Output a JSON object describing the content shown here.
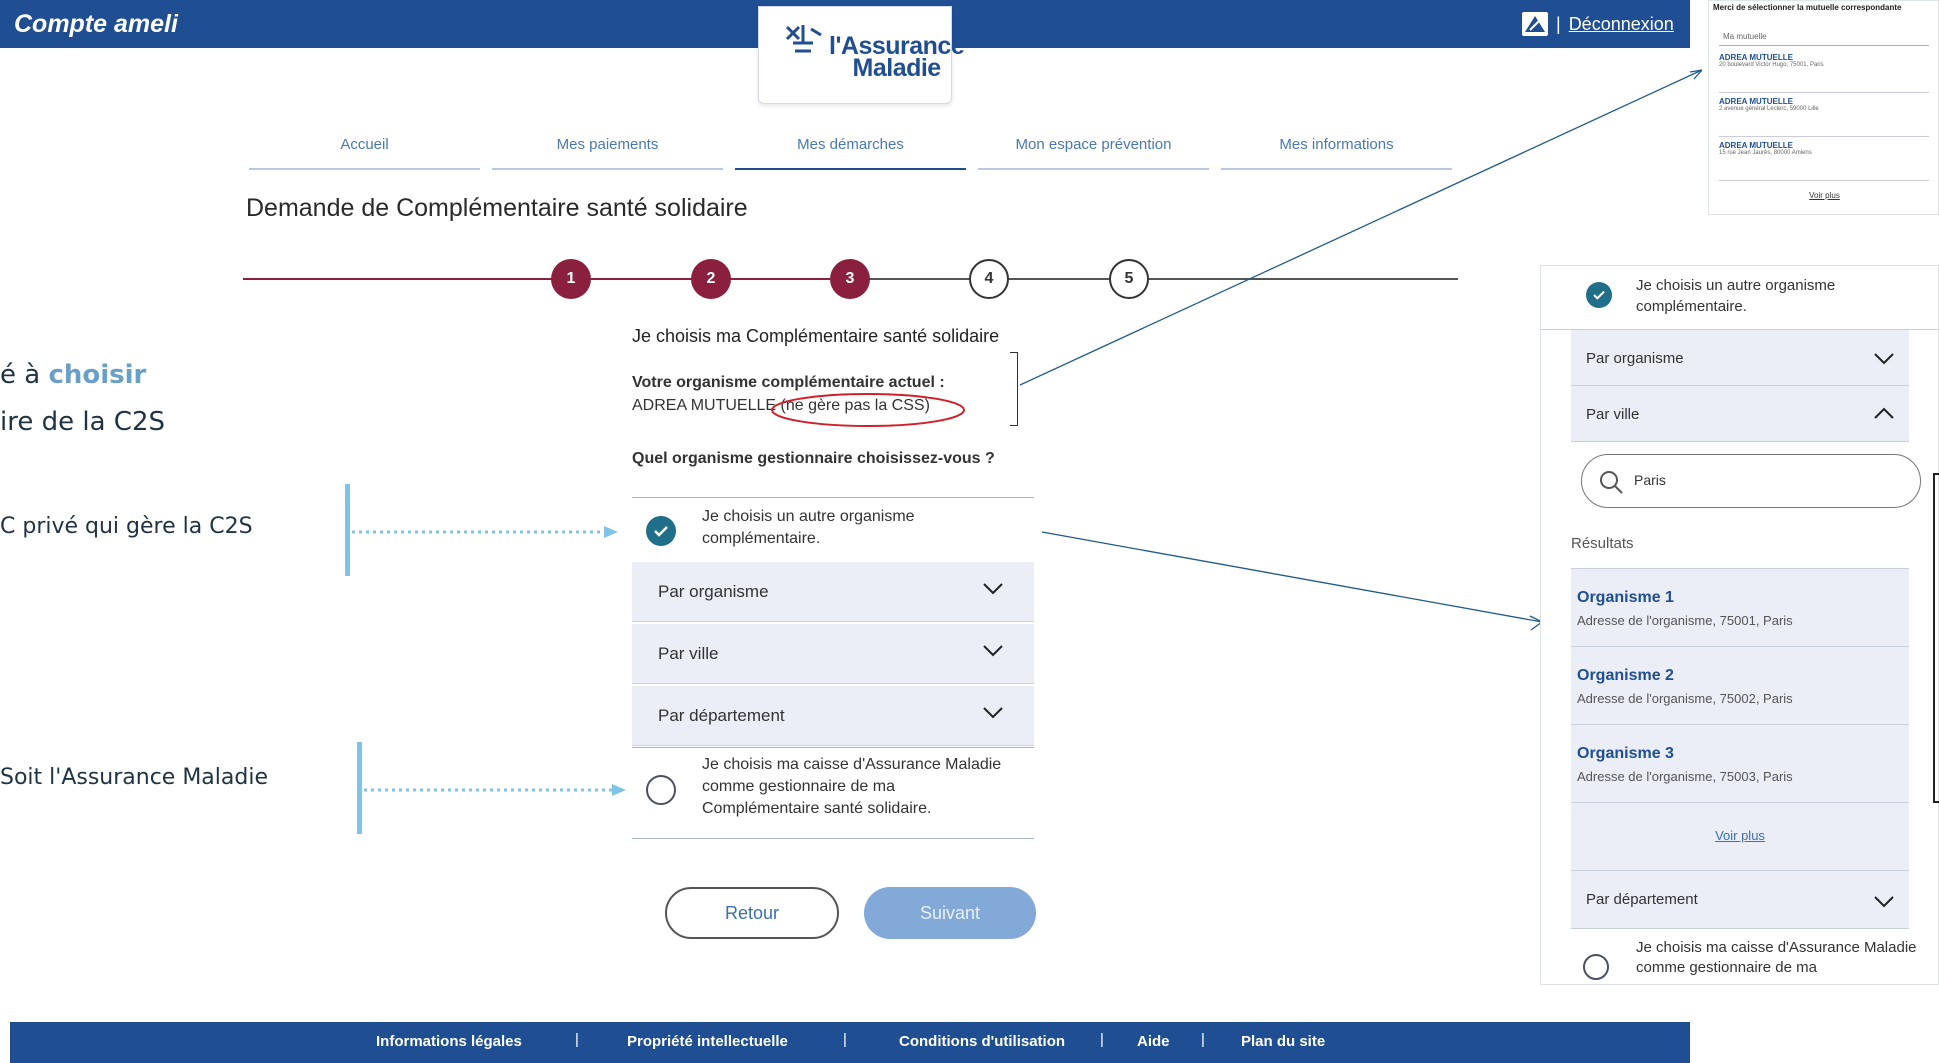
{
  "header": {
    "brand": "Compte ameli",
    "logo_line1": "l'Assurance",
    "logo_line2": "Maladie",
    "separator": "|",
    "logout": "Déconnexion"
  },
  "nav": {
    "tabs": [
      "Accueil",
      "Mes paiements",
      "Mes démarches",
      "Mon espace prévention",
      "Mes informations"
    ],
    "active_index": 2
  },
  "page_title": "Demande de Complémentaire santé solidaire",
  "stepper": {
    "steps": [
      "1",
      "2",
      "3",
      "4",
      "5"
    ],
    "current": 3,
    "done_color": "#8a1f3e"
  },
  "form": {
    "title": "Je choisis ma Complémentaire santé solidaire",
    "current_org_label": "Votre organisme complémentaire actuel :",
    "current_org_name": "ADREA MUTUELLE",
    "current_org_note": "(ne gère pas la CSS)",
    "question": "Quel organisme gestionnaire choisissez-vous ?",
    "option_other": {
      "line1": "Je choisis un autre organisme",
      "line2": "complémentaire.",
      "checked": true
    },
    "accordions": [
      "Par organisme",
      "Par ville",
      "Par département"
    ],
    "option_cpam": {
      "line1": "Je choisis ma caisse d'Assurance Maladie",
      "line2": "comme gestionnaire de ma",
      "line3": "Complémentaire santé solidaire.",
      "checked": false
    },
    "btn_back": "Retour",
    "btn_next": "Suivant"
  },
  "annotations": {
    "line1_prefix": "é à ",
    "line1_accent": "choisir",
    "line2": "ire de la C2S",
    "item1": "C privé qui gère la C2S",
    "item2": "Soit l'Assurance Maladie"
  },
  "footer": {
    "items": [
      "Informations légales",
      "Propriété intellectuelle",
      "Conditions d'utilisation",
      "Aide",
      "Plan du site"
    ],
    "separator": "|"
  },
  "panel_list": {
    "title": "Merci de sélectionner la mutuelle correspondante",
    "input_value": "Ma mutuelle",
    "items": [
      {
        "name": "ADREA MUTUELLE",
        "address": "20 boulevard Victor Hugo, 75001, Paris"
      },
      {
        "name": "ADREA MUTUELLE",
        "address": "2 avenue général Leclerc, 59000 Lille"
      },
      {
        "name": "ADREA MUTUELLE",
        "address": "15 rue Jean Jaurès, 80000 Amiens"
      }
    ],
    "more": "Voir plus"
  },
  "panel_detail": {
    "option_other_line1": "Je choisis un autre organisme",
    "option_other_line2": "complémentaire.",
    "by_org": "Par organisme",
    "by_city": "Par ville",
    "search_value": "Paris",
    "results_label": "Résultats",
    "results": [
      {
        "name": "Organisme 1",
        "address": "Adresse de l'organisme, 75001, Paris"
      },
      {
        "name": "Organisme 2",
        "address": "Adresse de l'organisme, 75002, Paris"
      },
      {
        "name": "Organisme 3",
        "address": "Adresse de l'organisme, 75003, Paris"
      }
    ],
    "more": "Voir plus",
    "by_dept": "Par département",
    "option_cpam_line1": "Je choisis ma caisse d'Assurance Maladie",
    "option_cpam_line2": "comme gestionnaire de ma"
  }
}
